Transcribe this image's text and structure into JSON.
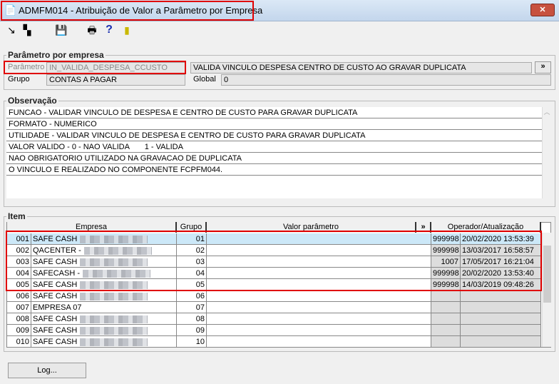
{
  "window": {
    "title": "ADMFM014 - Atribuição de Valor a Parâmetro por Empresa",
    "close": "✕"
  },
  "toolbar": [
    "arrow-icon",
    "windows-icon",
    "save-icon",
    "print-icon",
    "help-icon",
    "exit-door-icon"
  ],
  "param": {
    "legend": "Parâmetro por empresa",
    "param_label": "Parâmetro",
    "param_value": "IN_VALIDA_DESPESA_CCUSTO",
    "description": "VALIDA VINCULO DESPESA CENTRO DE CUSTO AO GRAVAR DUPLICATA",
    "more": "»",
    "group_label": "Grupo",
    "group_value": "CONTAS A PAGAR",
    "global_label": "Global",
    "global_value": "0"
  },
  "obs": {
    "legend": "Observação",
    "lines": [
      "FUNCAO - VALIDAR VINCULO DE DESPESA E CENTRO DE CUSTO PARA GRAVAR DUPLICATA",
      "FORMATO - NUMERICO",
      "UTILIDADE - VALIDAR VINCULO DE DESPESA E CENTRO DE CUSTO PARA GRAVAR DUPLICATA",
      "VALOR VALIDO - 0 - NAO VALIDA       1 - VALIDA",
      "NAO OBRIGATORIO UTILIZADO NA GRAVACAO DE DUPLICATA",
      "O VINCULO E REALIZADO NO COMPONENTE FCPFM044."
    ]
  },
  "items": {
    "legend": "Item",
    "headers": {
      "empresa": "Empresa",
      "grupo": "Grupo",
      "valor": "Valor parâmetro",
      "more": "»",
      "operador": "Operador/Atualização"
    },
    "rows": [
      {
        "num": "001",
        "empresa": "SAFE CASH",
        "grupo": "01",
        "valor": "",
        "operador": "999998",
        "data": "20/02/2020 13:53:39",
        "selected": true
      },
      {
        "num": "002",
        "empresa": "QACENTER -",
        "grupo": "02",
        "valor": "",
        "operador": "999998",
        "data": "13/03/2017 16:58:57"
      },
      {
        "num": "003",
        "empresa": "SAFE CASH",
        "grupo": "03",
        "valor": "",
        "operador": "1007",
        "data": "17/05/2017 16:21:04"
      },
      {
        "num": "004",
        "empresa": "SAFECASH -",
        "grupo": "04",
        "valor": "",
        "operador": "999998",
        "data": "20/02/2020 13:53:40"
      },
      {
        "num": "005",
        "empresa": "SAFE CASH",
        "grupo": "05",
        "valor": "",
        "operador": "999998",
        "data": "14/03/2019 09:48:26"
      },
      {
        "num": "006",
        "empresa": "SAFE CASH",
        "grupo": "06",
        "valor": "",
        "operador": "",
        "data": ""
      },
      {
        "num": "007",
        "empresa": "EMPRESA 07",
        "grupo": "07",
        "valor": "",
        "operador": "",
        "data": ""
      },
      {
        "num": "008",
        "empresa": "SAFE CASH",
        "grupo": "08",
        "valor": "",
        "operador": "",
        "data": ""
      },
      {
        "num": "009",
        "empresa": "SAFE CASH",
        "grupo": "09",
        "valor": "",
        "operador": "",
        "data": ""
      },
      {
        "num": "010",
        "empresa": "SAFE CASH",
        "grupo": "10",
        "valor": "",
        "operador": "",
        "data": ""
      }
    ]
  },
  "footer": {
    "log": "Log..."
  }
}
